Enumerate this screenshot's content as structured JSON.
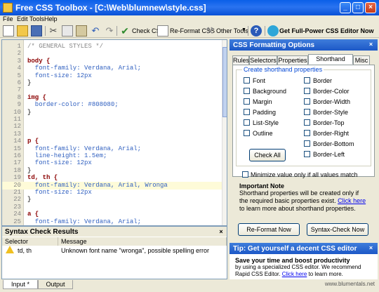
{
  "window": {
    "title": "Free CSS Toolbox - [C:\\Web\\blumnew\\style.css]"
  },
  "menu": [
    "File",
    "Edit",
    "Tools",
    "Help"
  ],
  "toolbar": {
    "check_css": "Check CSS",
    "reformat_css": "Re-Format CSS",
    "other_tools": "Other Tools",
    "get_editor": "Get Full-Power CSS Editor Now"
  },
  "editor": {
    "lines": [
      {
        "n": "1",
        "t": "/* GENERAL STYLES */",
        "k": "comment"
      },
      {
        "n": "2",
        "t": "",
        "k": "plain"
      },
      {
        "n": "3",
        "t": "body {",
        "k": "sel"
      },
      {
        "n": "4",
        "t": "  font-family: Verdana, Arial;",
        "k": "prop"
      },
      {
        "n": "5",
        "t": "  font-size: 12px",
        "k": "prop"
      },
      {
        "n": "6",
        "t": "}",
        "k": "brace"
      },
      {
        "n": "7",
        "t": "",
        "k": "plain"
      },
      {
        "n": "8",
        "t": "img {",
        "k": "sel"
      },
      {
        "n": "9",
        "t": "  border-color: #808080;",
        "k": "prop"
      },
      {
        "n": "10",
        "t": "}",
        "k": "brace"
      },
      {
        "n": "11",
        "t": "",
        "k": "plain"
      },
      {
        "n": "12",
        "t": "",
        "k": "plain"
      },
      {
        "n": "13",
        "t": "",
        "k": "plain"
      },
      {
        "n": "14",
        "t": "p {",
        "k": "sel"
      },
      {
        "n": "15",
        "t": "  font-family: Verdana, Arial;",
        "k": "prop"
      },
      {
        "n": "16",
        "t": "  line-height: 1.5em;",
        "k": "prop"
      },
      {
        "n": "17",
        "t": "  font-size: 12px",
        "k": "prop"
      },
      {
        "n": "18",
        "t": "}",
        "k": "brace"
      },
      {
        "n": "19",
        "t": "td, th {",
        "k": "sel"
      },
      {
        "n": "20",
        "t": "  font-family: Verdana, Arial, Wronga",
        "k": "prop",
        "hl": true
      },
      {
        "n": "21",
        "t": "  font-size: 12px",
        "k": "prop"
      },
      {
        "n": "22",
        "t": "}",
        "k": "brace"
      },
      {
        "n": "23",
        "t": "",
        "k": "plain"
      },
      {
        "n": "24",
        "t": "a {",
        "k": "sel"
      },
      {
        "n": "25",
        "t": "  font-family: Verdana, Arial;",
        "k": "prop"
      }
    ]
  },
  "syntax": {
    "title": "Syntax Check Results",
    "col_selector": "Selector",
    "col_message": "Message",
    "row_selector": "td, th",
    "row_message": "Unknown font name \"wronga\", possible spelling error"
  },
  "bottom_tabs": [
    "Input *",
    "Output"
  ],
  "options": {
    "header": "CSS Formatting Options",
    "tabs": [
      "Rules",
      "Selectors",
      "Properties",
      "Shorthand Prop.",
      "Misc"
    ],
    "group_label": "Create shorthand properties",
    "left_items": [
      "Font",
      "Background",
      "Margin",
      "Padding",
      "List-Style",
      "Outline"
    ],
    "right_items": [
      "Border",
      "Border-Color",
      "Border-Width",
      "Border-Style",
      "Border-Top",
      "Border-Right",
      "Border-Bottom",
      "Border-Left"
    ],
    "check_all": "Check All",
    "minimize": "Minimize value only if all values match",
    "note_title": "Important Note",
    "note_text_1": "Shorthand properties will be created only if the required basic properties exist.",
    "note_link": "Click here",
    "note_text_2": "to learn more about shorthand properties."
  },
  "actions": {
    "reformat": "Re-Format Now",
    "syntax": "Syntax-Check Now"
  },
  "tip": {
    "header": "Tip: Get yourself a decent CSS editor",
    "title": "Save your time and boost productivity",
    "text_1": "by using a specialized CSS editor. We recommend Rapid CSS Editor.",
    "link": "Click here",
    "text_2": "to learn more."
  },
  "footer": "www.blumentals.net"
}
